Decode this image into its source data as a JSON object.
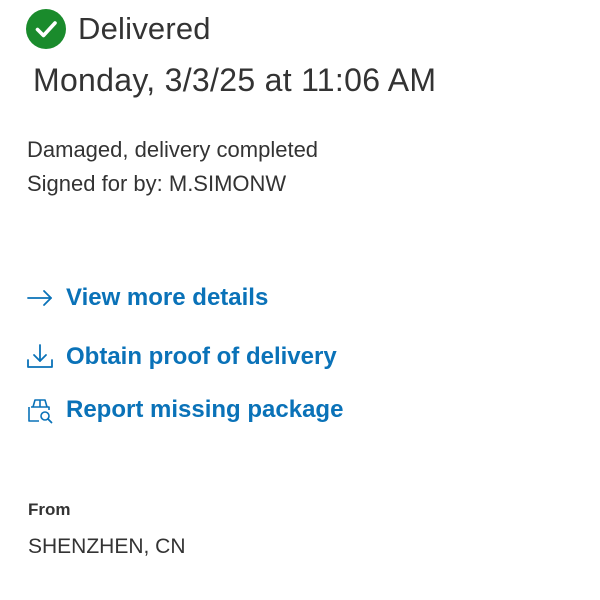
{
  "colors": {
    "success": "#1a8b2c",
    "link": "#0a72b8",
    "text": "#333333"
  },
  "status": {
    "icon": "check-circle-icon",
    "label": "Delivered"
  },
  "delivery": {
    "datetime": "Monday, 3/3/25 at 11:06 AM",
    "note": "Damaged, delivery completed",
    "signed_by": "Signed for by: M.SIMONW"
  },
  "actions": [
    {
      "icon": "arrow-right-icon",
      "label": "View more details"
    },
    {
      "icon": "download-icon",
      "label": "Obtain proof of delivery"
    },
    {
      "icon": "package-search-icon",
      "label": "Report missing package"
    }
  ],
  "origin": {
    "heading": "From",
    "value": "SHENZHEN, CN"
  }
}
